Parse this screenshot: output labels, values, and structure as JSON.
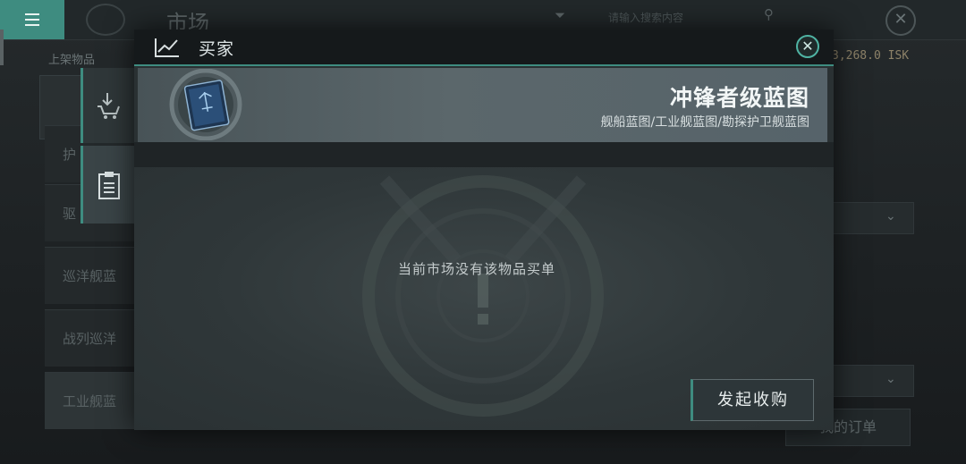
{
  "background": {
    "page_title": "市场",
    "search_placeholder": "请输入搜索内容",
    "left_section_label": "上架物品",
    "isk_balance": "3,268.0 ISK",
    "sidebar_items": [
      "护",
      "驱",
      "巡洋舰蓝",
      "战列巡洋",
      "工业舰蓝"
    ],
    "my_orders_label": "我的订单"
  },
  "modal": {
    "title": "买家",
    "item": {
      "name": "冲锋者级蓝图",
      "category": "舰船蓝图/工业舰蓝图/勘探护卫舰蓝图"
    },
    "empty_message": "当前市场没有该物品买单",
    "create_buy_order_label": "发起收购"
  },
  "colors": {
    "accent": "#3e8c80",
    "isk": "#8d8268"
  },
  "icons": {
    "menu": "hamburger-icon",
    "chart": "line-chart-icon",
    "close": "close-icon",
    "sell": "download-cart-icon",
    "orders": "clipboard-icon"
  }
}
